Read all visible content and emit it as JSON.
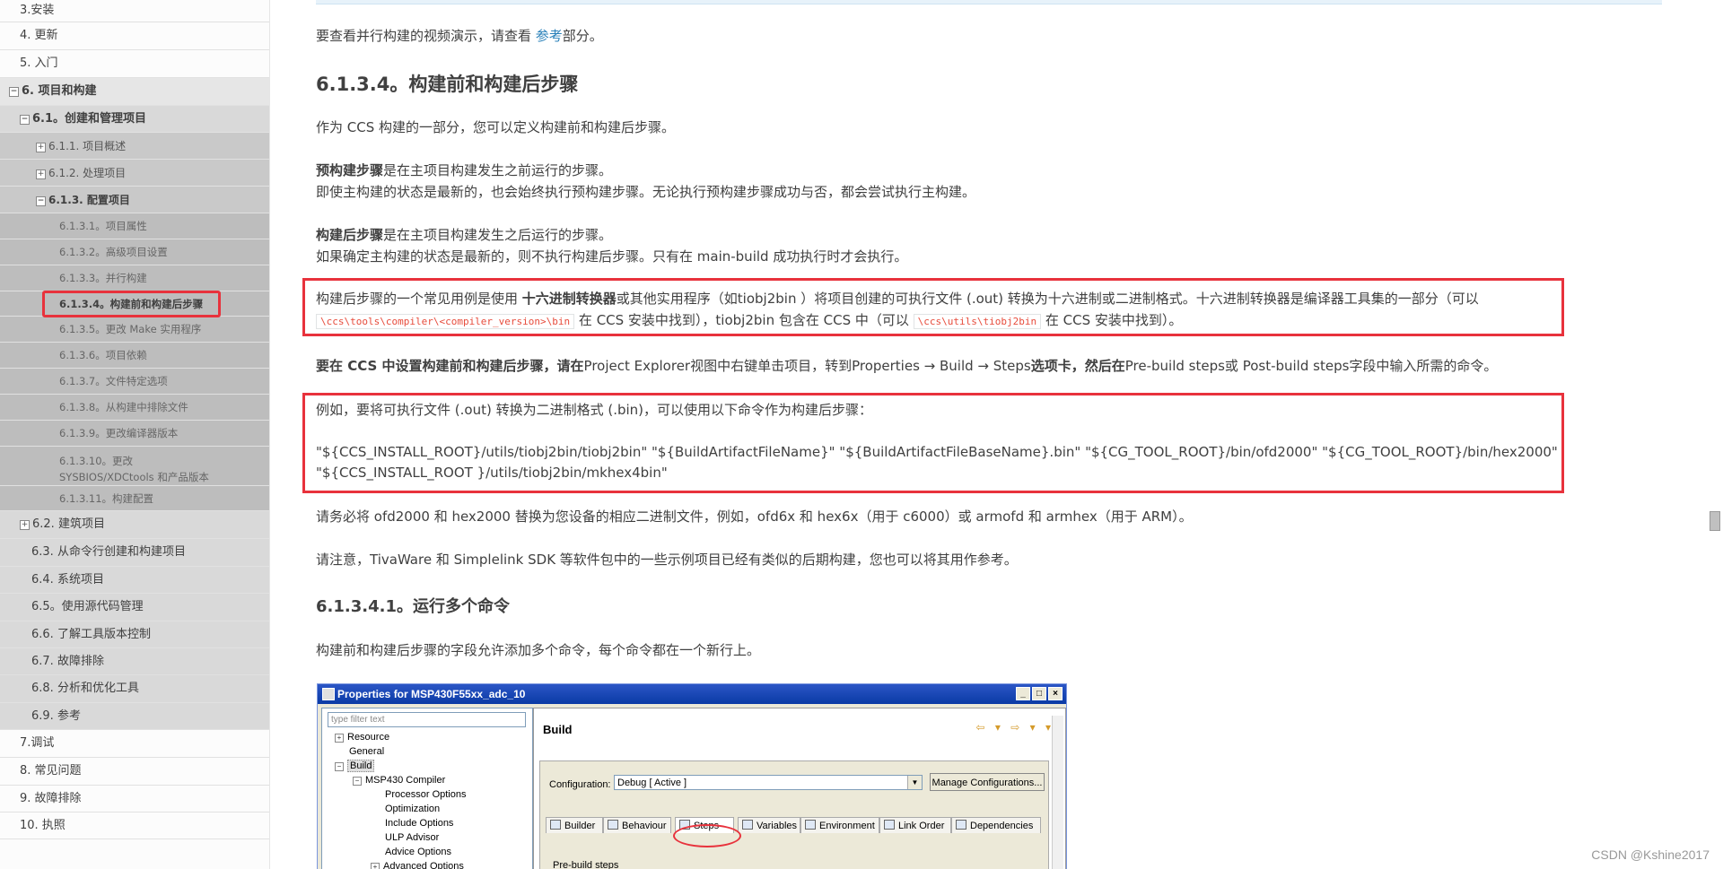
{
  "sidebar": {
    "items": [
      {
        "label": "3.安装"
      },
      {
        "label": "4. 更新"
      },
      {
        "label": "5. 入门"
      },
      {
        "label": "6. 项目和构建",
        "expander": "⊟"
      },
      {
        "label": "6.1。创建和管理项目",
        "expander": "⊟"
      },
      {
        "label": "6.1.1. 项目概述",
        "expander": "⊞"
      },
      {
        "label": "6.1.2. 处理项目",
        "expander": "⊞"
      },
      {
        "label": "6.1.3. 配置项目",
        "expander": "⊟"
      },
      {
        "label": "6.1.3.1。项目属性"
      },
      {
        "label": "6.1.3.2。高级项目设置"
      },
      {
        "label": "6.1.3.3。并行构建"
      },
      {
        "label": "6.1.3.4。构建前和构建后步骤"
      },
      {
        "label": "6.1.3.5。更改 Make 实用程序"
      },
      {
        "label": "6.1.3.6。项目依赖"
      },
      {
        "label": "6.1.3.7。文件特定选项"
      },
      {
        "label": "6.1.3.8。从构建中排除文件"
      },
      {
        "label": "6.1.3.9。更改编译器版本"
      },
      {
        "label": "6.1.3.10。更改",
        "label2": "SYSBIOS/XDCtools 和产品版本"
      },
      {
        "label": "6.1.3.11。构建配置"
      },
      {
        "label": "6.2. 建筑项目",
        "expander": "⊞"
      },
      {
        "label": "6.3. 从命令行创建和构建项目"
      },
      {
        "label": "6.4. 系统项目"
      },
      {
        "label": "6.5。使用源代码管理"
      },
      {
        "label": "6.6. 了解工具版本控制"
      },
      {
        "label": "6.7. 故障排除"
      },
      {
        "label": "6.8. 分析和优化工具"
      },
      {
        "label": "6.9. 参考"
      },
      {
        "label": "7.调试"
      },
      {
        "label": "8. 常见问题"
      },
      {
        "label": "9. 故障排除"
      },
      {
        "label": "10. 执照"
      }
    ]
  },
  "content": {
    "intro_prefix": "要查看并行构建的视频演示，请查看 ",
    "intro_link": "参考",
    "intro_suffix": "部分。",
    "heading": "6.1.3.4。构建前和构建后步骤",
    "p1": "作为 CCS 构建的一部分，您可以定义构建前和构建后步骤。",
    "pre_bold": "预构建步骤",
    "pre_rest": "是在主项目构建发生之前运行的步骤。",
    "pre_line2": "即使主构建的状态是最新的，也会始终执行预构建步骤。无论执行预构建步骤成功与否，都会尝试执行主构建。",
    "post_bold": "构建后步骤",
    "post_rest": "是在主项目构建发生之后运行的步骤。",
    "post_line2": "如果确定主构建的状态是最新的，则不执行构建后步骤。只有在 main-build 成功执行时才会执行。",
    "box1_a": "构建后步骤的一个常见用例是使用 ",
    "box1_bold": "十六进制转换器",
    "box1_b": "或其他实用程序（如tiobj2bin ）将项目创建的可执行文件 (.out) 转换为十六进制或二进制格式。十六进制转换器是编译器工具集的一部分（可以",
    "box1_code1": "\\ccs\\tools\\compiler\\<compiler_version>\\bin",
    "box1_c": " 在 CCS 安装中找到），tiobj2bin 包含在 CCS 中（可以 ",
    "box1_code2": "\\ccs\\utils\\tiobj2bin",
    "box1_d": " 在 CCS 安装中找到）。",
    "setup_bold1": "要在 CCS 中设置构建前和构建后步骤，请在",
    "setup_a": "Project Explorer视图中右键单击项目，转到Properties → Build → Steps",
    "setup_bold2": "选项卡，然后在",
    "setup_b": "Pre-build steps或 Post-build steps字段中输入所需的命令。",
    "box2_line1": "例如，要将可执行文件 (.out) 转换为二进制格式 (.bin)，可以使用以下命令作为构建后步骤：",
    "box2_line2": "\"${CCS_INSTALL_ROOT}/utils/tiobj2bin/tiobj2bin\" \"${BuildArtifactFileName}\" \"${BuildArtifactFileBaseName}.bin\" \"${CG_TOOL_ROOT}/bin/ofd2000\" \"${CG_TOOL_ROOT}/bin/hex2000\"",
    "box2_line3": "\"${CCS_INSTALL_ROOT }/utils/tiobj2bin/mkhex4bin\"",
    "p_replace": "请务必将 ofd2000 和 hex2000 替换为您设备的相应二进制文件，例如，ofd6x 和 hex6x（用于 c6000）或 armofd 和 armhex（用于 ARM）。",
    "p_note": "请注意，TivaWare 和 Simplelink SDK 等软件包中的一些示例项目已经有类似的后期构建，您也可以将其用作参考。",
    "subheading": "6.1.3.4.1。运行多个命令",
    "p_multi": "构建前和构建后步骤的字段允许添加多个命令，每个命令都在一个新行上。"
  },
  "dialog": {
    "title": "Properties for MSP430F55xx_adc_10",
    "filter_placeholder": "type filter text",
    "tree": [
      "Resource",
      "General",
      "Build",
      "MSP430 Compiler",
      "Processor Options",
      "Optimization",
      "Include Options",
      "ULP Advisor",
      "Advice Options",
      "Advanced Options"
    ],
    "build_title": "Build",
    "config_label": "Configuration:",
    "config_value": "Debug  [ Active ]",
    "manage_button": "Manage Configurations...",
    "tabs": [
      "Builder",
      "Behaviour",
      "Steps",
      "Variables",
      "Environment",
      "Link Order",
      "Dependencies"
    ],
    "prebuild_label": "Pre-build steps",
    "min_glyph": "_",
    "max_glyph": "□",
    "close_glyph": "×",
    "nav_arrows": "⇦ ▾ ⇨ ▾ ▾"
  },
  "watermark": "CSDN @Kshine2017"
}
